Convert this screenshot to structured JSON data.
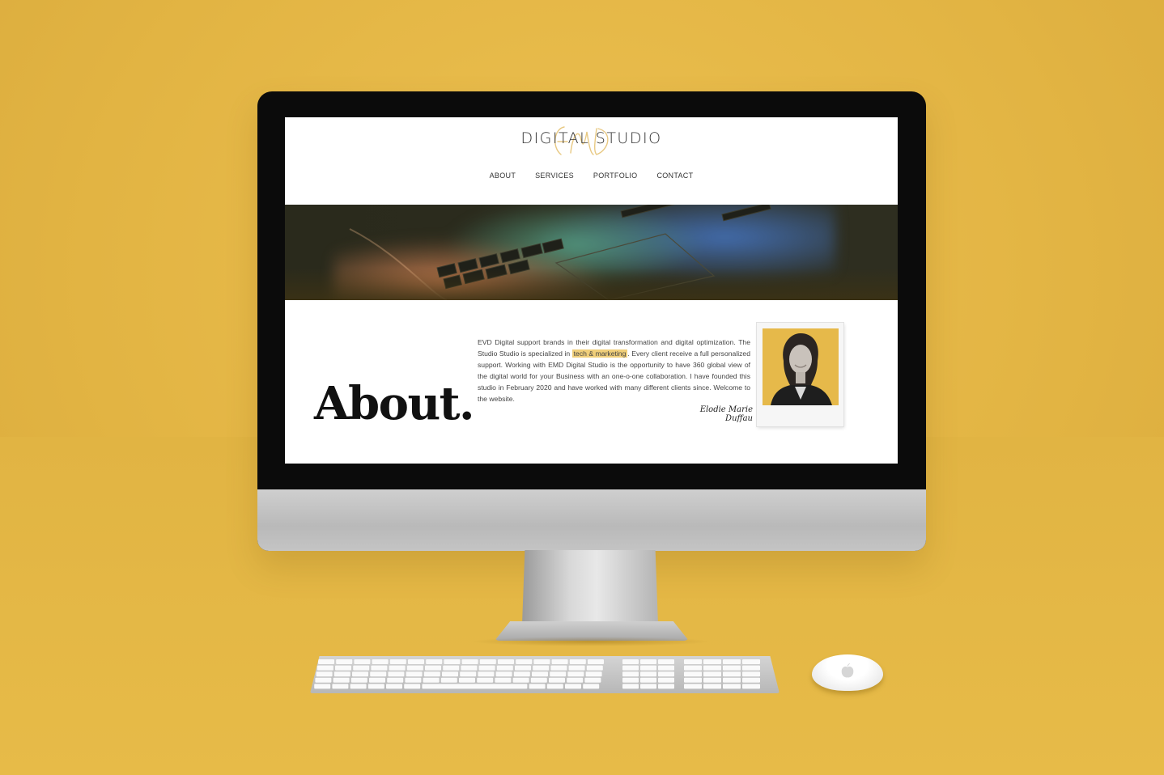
{
  "brand": {
    "name": "DIGITAL STUDIO",
    "monogram": "EMD"
  },
  "nav": {
    "items": [
      {
        "label": "ABOUT"
      },
      {
        "label": "SERVICES"
      },
      {
        "label": "PORTFOLIO"
      },
      {
        "label": "CONTACT"
      }
    ]
  },
  "about": {
    "title": "About.",
    "copy_before": "EVD Digital support brands in their digital transformation and digital optimization. The Studio Studio is specialized in ",
    "copy_highlight": "tech & marketing",
    "copy_after": ". Every client receive a full personalized support. Working with EMD Digital Studio is the opportunity to have 360 global view of the digital world for your Business with an one-o-one collaboration. I have founded this studio in February 2020 and have worked with many different clients since. Welcome to the website.",
    "signature": "Elodie Marie Duffau"
  },
  "colors": {
    "background": "#e2b443",
    "highlight": "#f0cf7a",
    "photo_background": "#e6b94a"
  },
  "icons": {
    "apple_logo": "apple-logo-icon"
  }
}
